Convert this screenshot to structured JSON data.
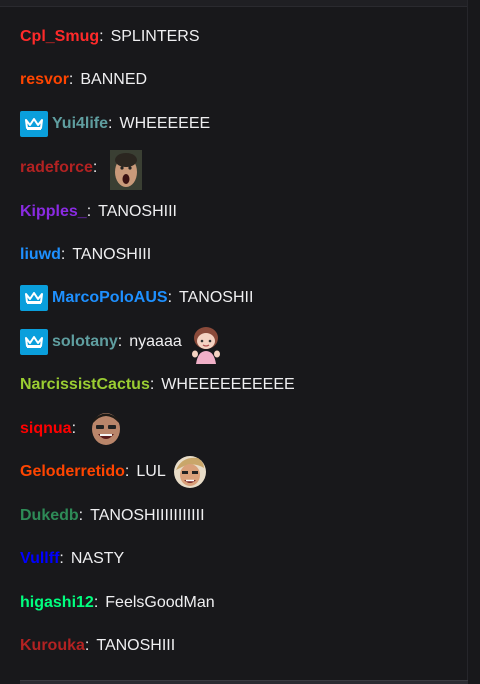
{
  "chat": {
    "messages": [
      {
        "username": "Cpl_Smug",
        "color": "#ff2a2a",
        "sep": ":",
        "text": "SPLINTERS",
        "badge": null,
        "emote": null
      },
      {
        "username": "resvor",
        "color": "#ff4500",
        "sep": ":",
        "text": "BANNED",
        "badge": null,
        "emote": null
      },
      {
        "username": "Yui4life",
        "color": "#5f9ea0",
        "sep": ":",
        "text": "WHEEEEEE",
        "badge": "subscriber-crown-icon",
        "emote": null
      },
      {
        "username": "radeforce",
        "color": "#b22222",
        "sep": ":",
        "text": "",
        "badge": null,
        "emote": "screaming-face-emote"
      },
      {
        "username": "Kipples_",
        "color": "#8a2be2",
        "sep": ":",
        "text": "TANOSHIII",
        "badge": null,
        "emote": null
      },
      {
        "username": "liuwd",
        "color": "#1e90ff",
        "sep": ":",
        "text": "TANOSHIII",
        "badge": null,
        "emote": null
      },
      {
        "username": "MarcoPoloAUS",
        "color": "#1e90ff",
        "sep": ":",
        "text": "TANOSHII",
        "badge": "subscriber-crown-icon",
        "emote": null
      },
      {
        "username": "solotany",
        "color": "#5f9ea0",
        "sep": ":",
        "text": "nyaaaa",
        "badge": "subscriber-crown-icon",
        "emote": "anime-girl-emote"
      },
      {
        "username": "NarcissistCactus",
        "color": "#9acd32",
        "sep": ":",
        "text": "WHEEEEEEEEEE",
        "badge": null,
        "emote": null
      },
      {
        "username": "siqnua",
        "color": "#ff0000",
        "sep": ":",
        "text": "",
        "badge": null,
        "emote": "laughing-face-emote"
      },
      {
        "username": "Geloderretido",
        "color": "#ff4500",
        "sep": ":",
        "text": "LUL",
        "badge": null,
        "emote": "lul-emote"
      },
      {
        "username": "Dukedb",
        "color": "#2e8b57",
        "sep": ":",
        "text": "TANOSHIIIIIIIIIII",
        "badge": null,
        "emote": null
      },
      {
        "username": "Vullff",
        "color": "#0000ff",
        "sep": ":",
        "text": "NASTY",
        "badge": null,
        "emote": null
      },
      {
        "username": "higashi12",
        "color": "#00ff7f",
        "sep": ":",
        "text": "FeelsGoodMan",
        "badge": null,
        "emote": null
      },
      {
        "username": "Kurouka",
        "color": "#b22222",
        "sep": ":",
        "text": "TANOSHIII",
        "badge": null,
        "emote": null
      }
    ]
  }
}
